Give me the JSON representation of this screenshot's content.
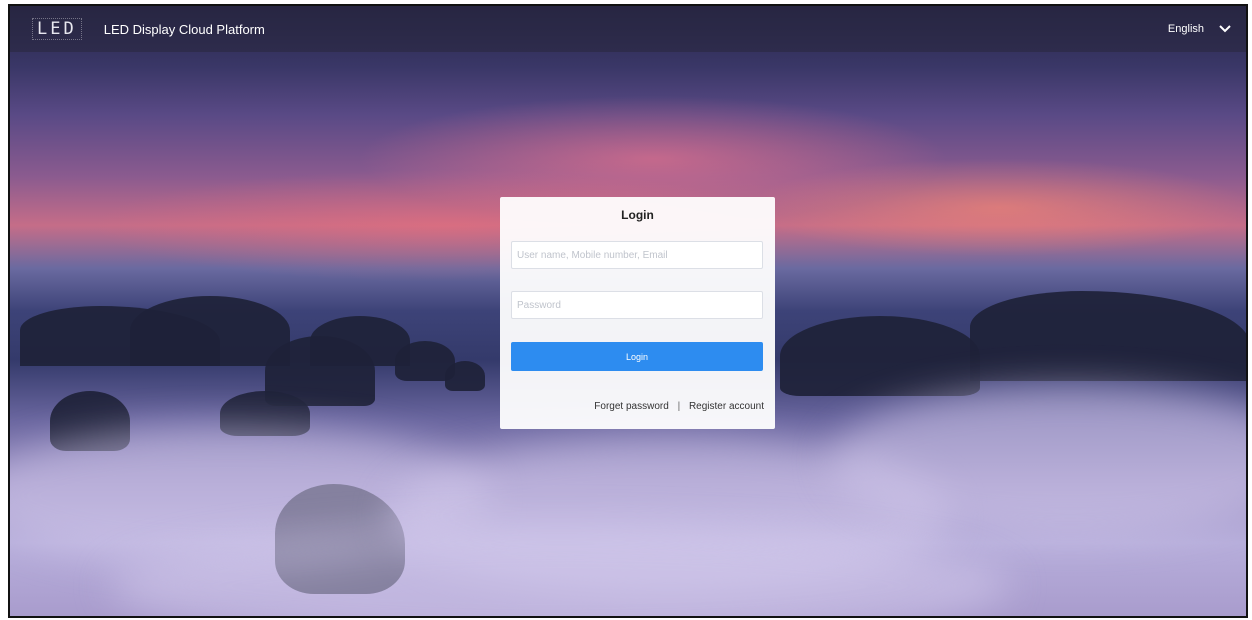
{
  "header": {
    "logo_text": "LED",
    "app_title": "LED Display Cloud Platform",
    "language": "English",
    "language_icon": "chevron-down-icon"
  },
  "login": {
    "title": "Login",
    "username_placeholder": "User name, Mobile number, Email",
    "password_placeholder": "Password",
    "username_value": "",
    "password_value": "",
    "button_label": "Login",
    "forget_password": "Forget password",
    "separator": "|",
    "register_account": "Register account"
  },
  "colors": {
    "primary_button": "#2d8cf0",
    "header_bg": "#28263c"
  }
}
